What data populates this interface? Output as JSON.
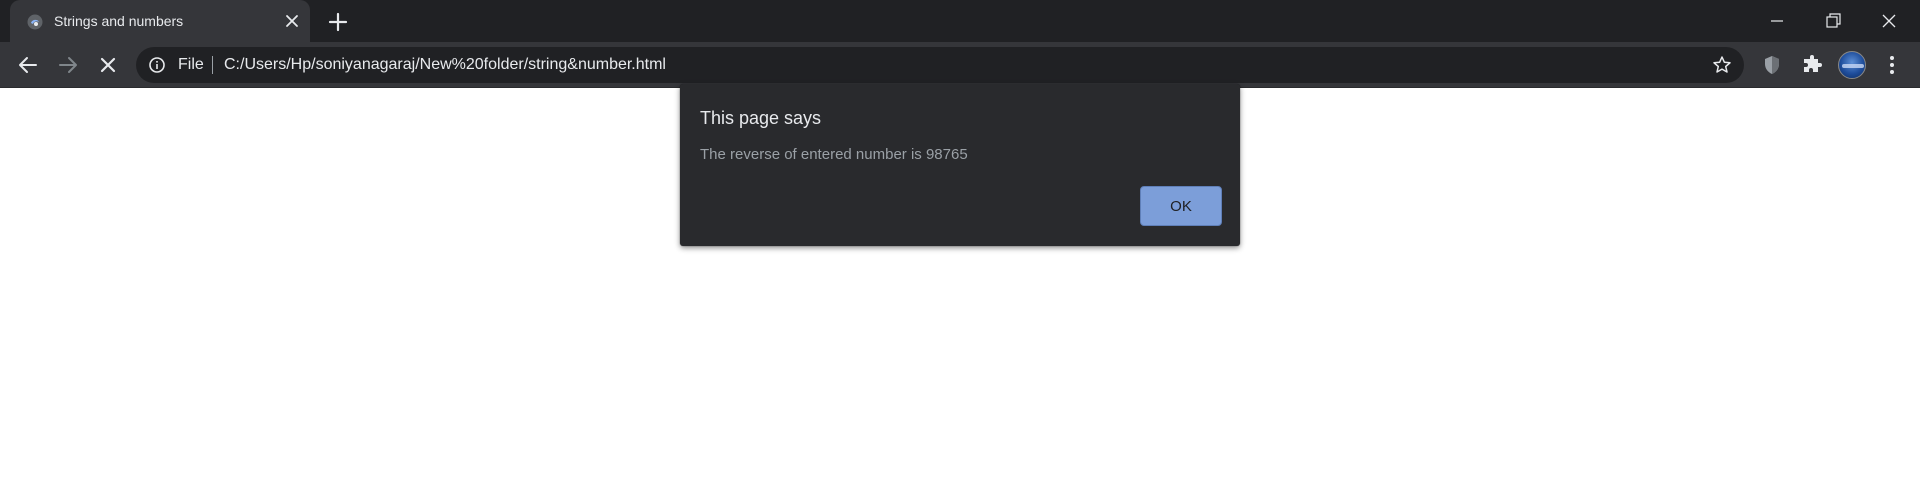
{
  "browser": {
    "tab": {
      "title": "Strings and numbers",
      "favicon": "html-file-icon"
    },
    "omnibox": {
      "scheme_label": "File",
      "url": "C:/Users/Hp/soniyanagaraj/New%20folder/string&number.html"
    },
    "icons": {
      "back": "back-arrow-icon",
      "forward": "forward-arrow-icon",
      "stop": "stop-loading-icon",
      "info": "info-icon",
      "bookmark": "star-icon",
      "shield_extension": "shield-icon",
      "extensions": "puzzle-icon",
      "menu": "more-vert-icon",
      "new_tab": "plus-icon",
      "minimize": "minimize-icon",
      "restore": "restore-icon",
      "close": "close-icon"
    }
  },
  "dialog": {
    "title": "This page says",
    "message": "The reverse of entered number is 98765",
    "ok_label": "OK"
  },
  "colors": {
    "frame": "#202124",
    "toolbar": "#35363a",
    "dialog_bg": "#292a2d",
    "ok_button": "#7c9ed9"
  }
}
